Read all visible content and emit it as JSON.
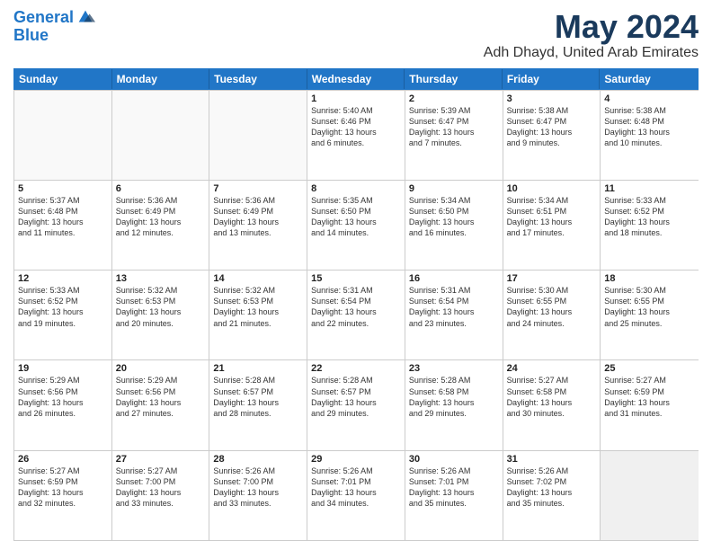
{
  "logo": {
    "line1": "General",
    "line2": "Blue"
  },
  "title": "May 2024",
  "location": "Adh Dhayd, United Arab Emirates",
  "weekdays": [
    "Sunday",
    "Monday",
    "Tuesday",
    "Wednesday",
    "Thursday",
    "Friday",
    "Saturday"
  ],
  "weeks": [
    [
      {
        "day": "",
        "info": ""
      },
      {
        "day": "",
        "info": ""
      },
      {
        "day": "",
        "info": ""
      },
      {
        "day": "1",
        "info": "Sunrise: 5:40 AM\nSunset: 6:46 PM\nDaylight: 13 hours\nand 6 minutes."
      },
      {
        "day": "2",
        "info": "Sunrise: 5:39 AM\nSunset: 6:47 PM\nDaylight: 13 hours\nand 7 minutes."
      },
      {
        "day": "3",
        "info": "Sunrise: 5:38 AM\nSunset: 6:47 PM\nDaylight: 13 hours\nand 9 minutes."
      },
      {
        "day": "4",
        "info": "Sunrise: 5:38 AM\nSunset: 6:48 PM\nDaylight: 13 hours\nand 10 minutes."
      }
    ],
    [
      {
        "day": "5",
        "info": "Sunrise: 5:37 AM\nSunset: 6:48 PM\nDaylight: 13 hours\nand 11 minutes."
      },
      {
        "day": "6",
        "info": "Sunrise: 5:36 AM\nSunset: 6:49 PM\nDaylight: 13 hours\nand 12 minutes."
      },
      {
        "day": "7",
        "info": "Sunrise: 5:36 AM\nSunset: 6:49 PM\nDaylight: 13 hours\nand 13 minutes."
      },
      {
        "day": "8",
        "info": "Sunrise: 5:35 AM\nSunset: 6:50 PM\nDaylight: 13 hours\nand 14 minutes."
      },
      {
        "day": "9",
        "info": "Sunrise: 5:34 AM\nSunset: 6:50 PM\nDaylight: 13 hours\nand 16 minutes."
      },
      {
        "day": "10",
        "info": "Sunrise: 5:34 AM\nSunset: 6:51 PM\nDaylight: 13 hours\nand 17 minutes."
      },
      {
        "day": "11",
        "info": "Sunrise: 5:33 AM\nSunset: 6:52 PM\nDaylight: 13 hours\nand 18 minutes."
      }
    ],
    [
      {
        "day": "12",
        "info": "Sunrise: 5:33 AM\nSunset: 6:52 PM\nDaylight: 13 hours\nand 19 minutes."
      },
      {
        "day": "13",
        "info": "Sunrise: 5:32 AM\nSunset: 6:53 PM\nDaylight: 13 hours\nand 20 minutes."
      },
      {
        "day": "14",
        "info": "Sunrise: 5:32 AM\nSunset: 6:53 PM\nDaylight: 13 hours\nand 21 minutes."
      },
      {
        "day": "15",
        "info": "Sunrise: 5:31 AM\nSunset: 6:54 PM\nDaylight: 13 hours\nand 22 minutes."
      },
      {
        "day": "16",
        "info": "Sunrise: 5:31 AM\nSunset: 6:54 PM\nDaylight: 13 hours\nand 23 minutes."
      },
      {
        "day": "17",
        "info": "Sunrise: 5:30 AM\nSunset: 6:55 PM\nDaylight: 13 hours\nand 24 minutes."
      },
      {
        "day": "18",
        "info": "Sunrise: 5:30 AM\nSunset: 6:55 PM\nDaylight: 13 hours\nand 25 minutes."
      }
    ],
    [
      {
        "day": "19",
        "info": "Sunrise: 5:29 AM\nSunset: 6:56 PM\nDaylight: 13 hours\nand 26 minutes."
      },
      {
        "day": "20",
        "info": "Sunrise: 5:29 AM\nSunset: 6:56 PM\nDaylight: 13 hours\nand 27 minutes."
      },
      {
        "day": "21",
        "info": "Sunrise: 5:28 AM\nSunset: 6:57 PM\nDaylight: 13 hours\nand 28 minutes."
      },
      {
        "day": "22",
        "info": "Sunrise: 5:28 AM\nSunset: 6:57 PM\nDaylight: 13 hours\nand 29 minutes."
      },
      {
        "day": "23",
        "info": "Sunrise: 5:28 AM\nSunset: 6:58 PM\nDaylight: 13 hours\nand 29 minutes."
      },
      {
        "day": "24",
        "info": "Sunrise: 5:27 AM\nSunset: 6:58 PM\nDaylight: 13 hours\nand 30 minutes."
      },
      {
        "day": "25",
        "info": "Sunrise: 5:27 AM\nSunset: 6:59 PM\nDaylight: 13 hours\nand 31 minutes."
      }
    ],
    [
      {
        "day": "26",
        "info": "Sunrise: 5:27 AM\nSunset: 6:59 PM\nDaylight: 13 hours\nand 32 minutes."
      },
      {
        "day": "27",
        "info": "Sunrise: 5:27 AM\nSunset: 7:00 PM\nDaylight: 13 hours\nand 33 minutes."
      },
      {
        "day": "28",
        "info": "Sunrise: 5:26 AM\nSunset: 7:00 PM\nDaylight: 13 hours\nand 33 minutes."
      },
      {
        "day": "29",
        "info": "Sunrise: 5:26 AM\nSunset: 7:01 PM\nDaylight: 13 hours\nand 34 minutes."
      },
      {
        "day": "30",
        "info": "Sunrise: 5:26 AM\nSunset: 7:01 PM\nDaylight: 13 hours\nand 35 minutes."
      },
      {
        "day": "31",
        "info": "Sunrise: 5:26 AM\nSunset: 7:02 PM\nDaylight: 13 hours\nand 35 minutes."
      },
      {
        "day": "",
        "info": ""
      }
    ]
  ]
}
